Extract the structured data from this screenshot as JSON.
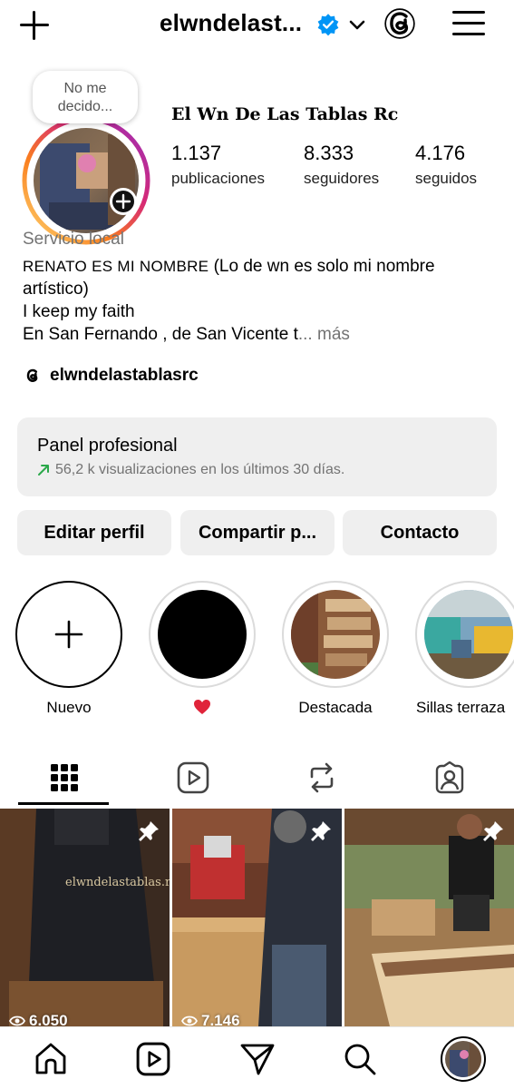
{
  "header": {
    "username": "elwndelast...",
    "verified_color": "#0095f6"
  },
  "profile": {
    "note": "No me decido...",
    "note_line1": "No me",
    "note_line2": "decido...",
    "display_name": "El Wn De Las Tablas Rc",
    "stats": [
      {
        "value": "1.137",
        "label": "publicaciones"
      },
      {
        "value": "8.333",
        "label": "seguidores"
      },
      {
        "value": "4.176",
        "label": "seguidos"
      }
    ],
    "category": "Servicio local",
    "bio_name": "RENATO ES MI NOMBRE",
    "bio_line1_rest": " (Lo de wn es solo mi nombre",
    "bio_line2": "artístico)",
    "bio_line3": "I keep my faith",
    "bio_line4": "En San Fernando , de San Vicente t",
    "bio_more": "... más",
    "threads_handle": "elwndelastablasrc"
  },
  "panel": {
    "title": "Panel profesional",
    "subtitle": "56,2 k visualizaciones en los últimos 30 días.",
    "trend_color": "#2ba84a"
  },
  "actions": {
    "edit": "Editar perfil",
    "share": "Compartir p...",
    "contact": "Contacto"
  },
  "highlights": [
    {
      "label": "Nuevo"
    },
    {
      "label": "❤️"
    },
    {
      "label": "Destacada"
    },
    {
      "label": "Sillas terraza"
    }
  ],
  "tabs": [
    {
      "icon": "grid-icon",
      "active": true
    },
    {
      "icon": "reels-icon",
      "active": false
    },
    {
      "icon": "reposts-icon",
      "active": false
    },
    {
      "icon": "tagged-icon",
      "active": false
    }
  ],
  "posts": [
    {
      "views": "6.050",
      "pinned": true,
      "overlay_text": "elwndelastablas.rc"
    },
    {
      "views": "7.146",
      "pinned": true
    },
    {
      "views": "",
      "pinned": true
    }
  ],
  "bottom_nav": [
    "home-icon",
    "reels-icon",
    "messages-icon",
    "search-icon",
    "profile-avatar"
  ]
}
